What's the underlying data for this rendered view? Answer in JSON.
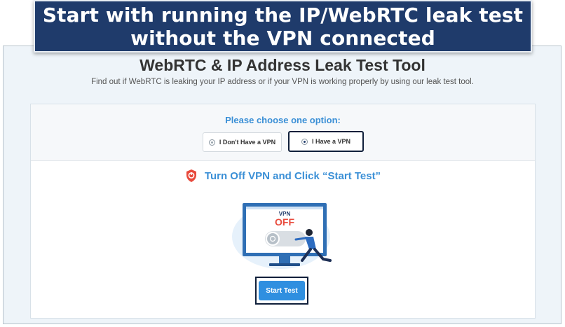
{
  "caption": {
    "line1": "Start with running the IP/WebRTC leak test",
    "line2": "without the VPN connected"
  },
  "page": {
    "title": "WebRTC & IP Address Leak Test Tool",
    "subtitle": "Find out if WebRTC is leaking your IP address or if your VPN is working properly by using our leak test tool."
  },
  "options": {
    "prompt": "Please choose one option:",
    "no_vpn_label": "I Don't Have a VPN",
    "have_vpn_label": "I Have a VPN",
    "selected": "have_vpn"
  },
  "instruction": {
    "text": "Turn Off VPN and Click “Start Test”",
    "icon": "shield-icon"
  },
  "illustration": {
    "screen_line1": "VPN",
    "screen_line2": "OFF"
  },
  "start_button": {
    "label": "Start Test"
  },
  "colors": {
    "accent_blue": "#3a8fd6",
    "button_blue": "#2f8fe0",
    "caption_bg": "#1f3b6b",
    "off_red": "#e84a3c"
  }
}
